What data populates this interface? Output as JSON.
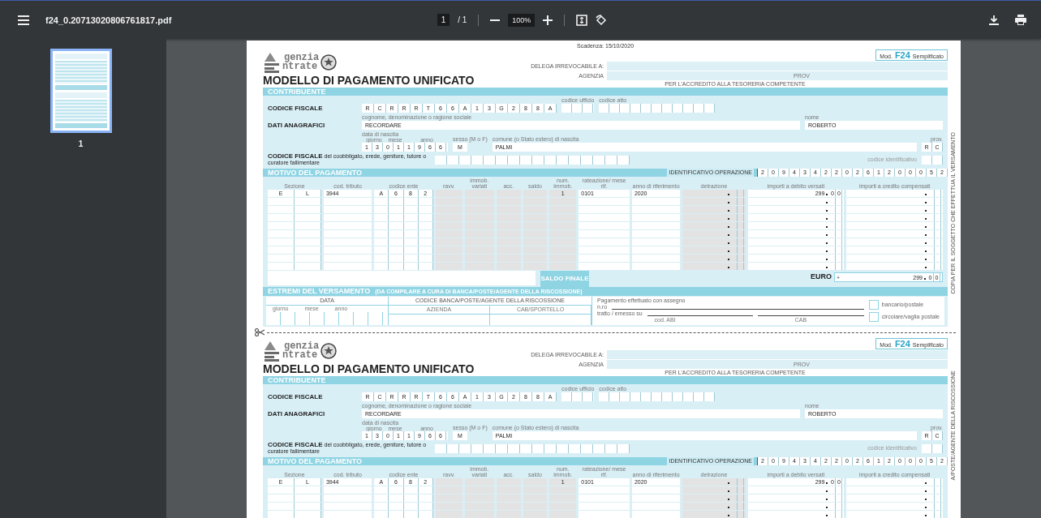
{
  "toolbar": {
    "filename": "f24_0.20713020806761817.pdf",
    "page_current": "1",
    "page_label": "/ 1",
    "zoom": "100%"
  },
  "sidebar": {
    "thumbnails": [
      {
        "label": "1",
        "selected": true
      }
    ]
  },
  "document": {
    "copies": [
      {
        "scadenza": "Scadenza: 15/10/2020",
        "logo_top": "genzia",
        "logo_bottom": "ntrate",
        "title": "MODELLO DI PAGAMENTO UNIFICATO",
        "model_prefix": "Mod.",
        "model_code": "F24",
        "model_variant": "Semplificato",
        "delega_label": "DELEGA IRREVOCABILE A:",
        "agenzia_label": "AGENZIA",
        "prov_label": "PROV",
        "accredito": "PER L'ACCREDITO ALLA TESORERIA COMPETENTE",
        "side_text": "COPIA PER IL SOGGETTO CHE EFFETTUA IL VERSAMENTO",
        "contribuente": {
          "title": "CONTRIBUENTE",
          "cf_label": "CODICE FISCALE",
          "cf": "R C R R R T 6 6 A 1 3 G 2 8 8 A",
          "ufficio_label": "codice ufficio",
          "atto_label": "codice atto",
          "anagrafici_label": "DATI ANAGRAFICI",
          "cognome_label": "cognome, denominazione o ragione sociale",
          "cognome": "RECORDARE",
          "nome_label": "nome",
          "nome": "ROBERTO",
          "nascita_label": "data di nascita",
          "giorno_label": "giorno",
          "mese_label": "mese",
          "anno_label": "anno",
          "nascita": "1 3 0 1 1 9 6 6",
          "sesso_label": "sesso (M o F)",
          "sesso": "M",
          "comune_label": "comune (o Stato estero) di nascita",
          "comune": "PALMI",
          "prov_label": "prov.",
          "prov": "R C",
          "coobbligato_label": "**CODICE FISCALE** del coobbligato, erede, genitore, tutore o curatore fallimentare",
          "identificativo_label": "codice identificativo"
        },
        "motivo": {
          "title": "MOTIVO DEL PAGAMENTO",
          "operazione_label": "IDENTIFICATIVO OPERAZIONE",
          "operazione": "2 0 9 4 3 4 2 2 0 2 6 1 2 0 0 0 5 2",
          "columns": [
            "Sezione",
            "cod. tributo",
            "codice ente",
            "ravv.",
            "immob. variati",
            "acc.",
            "saldo",
            "num. immob.",
            "rateazione/ mese rif.",
            "anno di riferimento",
            "detrazione",
            "importi a debito versati",
            "importi a credito compensati"
          ],
          "rows": [
            {
              "sezione": "E L",
              "tributo": "3944",
              "ente": "A 6 8 2",
              "num_immob": "1",
              "rateazione": "0101",
              "anno": "2020",
              "debito": "299",
              "debito_decimals": "0 0"
            }
          ]
        },
        "saldo": {
          "label": "SALDO FINALE",
          "currency": "EURO",
          "sign": "+",
          "integer": "299",
          "decimals": "0 0"
        },
        "estremi": {
          "title": "ESTREMI DEL VERSAMENTO",
          "note": "(DA COMPILARE A CURA DI BANCA/POSTE/AGENTE DELLA RISCOSSIONE)",
          "data_label": "DATA",
          "giorno_label": "giorno",
          "mese_label": "mese",
          "anno_label": "anno",
          "banca_label": "CODICE BANCA/POSTE/AGENTE DELLA RISCOSSIONE",
          "azienda_label": "AZIENDA",
          "cab_label": "CAB/SPORTELLO",
          "assegno_label": "Pagamento effettuato con assegno",
          "nro_label": "n.ro",
          "tratto_label": "tratto / emesso su",
          "abi_label": "cod. ABI",
          "cab2_label": "CAB",
          "options": [
            {
              "label": "bancario/postale",
              "checked": false
            },
            {
              "label": "circolare/vaglia postale",
              "checked": false
            }
          ]
        }
      },
      {
        "logo_top": "genzia",
        "logo_bottom": "ntrate",
        "title": "MODELLO DI PAGAMENTO UNIFICATO",
        "model_prefix": "Mod.",
        "model_code": "F24",
        "model_variant": "Semplificato",
        "delega_label": "DELEGA IRREVOCABILE A:",
        "agenzia_label": "AGENZIA",
        "prov_label": "PROV",
        "accredito": "PER L'ACCREDITO ALLA TESORERIA COMPETENTE",
        "side_text": "A/POSTE/AGENTE DELLA RISCOSSIONE",
        "contribuente": {
          "title": "CONTRIBUENTE",
          "cf_label": "CODICE FISCALE",
          "cf": "R C R R R T 6 6 A 1 3 G 2 8 8 A",
          "ufficio_label": "codice ufficio",
          "atto_label": "codice atto",
          "anagrafici_label": "DATI ANAGRAFICI",
          "cognome_label": "cognome, denominazione o ragione sociale",
          "cognome": "RECORDARE",
          "nome_label": "nome",
          "nome": "ROBERTO",
          "nascita_label": "data di nascita",
          "giorno_label": "giorno",
          "mese_label": "mese",
          "anno_label": "anno",
          "nascita": "1 3 0 1 1 9 6 6",
          "sesso_label": "sesso (M o F)",
          "sesso": "M",
          "comune_label": "comune (o Stato estero) di nascita",
          "comune": "PALMI",
          "prov_label": "prov.",
          "prov": "R C",
          "coobbligato_label": "**CODICE FISCALE** del coobbligato, erede, genitore, tutore o curatore fallimentare",
          "identificativo_label": "codice identificativo"
        },
        "motivo": {
          "title": "MOTIVO DEL PAGAMENTO",
          "operazione_label": "IDENTIFICATIVO OPERAZIONE",
          "operazione": "2 0 9 4 3 4 2 2 0 2 6 1 2 0 0 0 5 2",
          "columns": [
            "Sezione",
            "cod. tributo",
            "codice ente",
            "ravv.",
            "immob. variati",
            "acc.",
            "saldo",
            "num. immob.",
            "rateazione/ mese rif.",
            "anno di riferimento",
            "detrazione",
            "importi a debito versati",
            "importi a credito compensati"
          ],
          "rows": [
            {
              "sezione": "E L",
              "tributo": "3944",
              "ente": "A 6 8 2",
              "num_immob": "1",
              "rateazione": "0101",
              "anno": "2020",
              "debito": "299",
              "debito_decimals": "0 0"
            }
          ]
        }
      }
    ]
  }
}
